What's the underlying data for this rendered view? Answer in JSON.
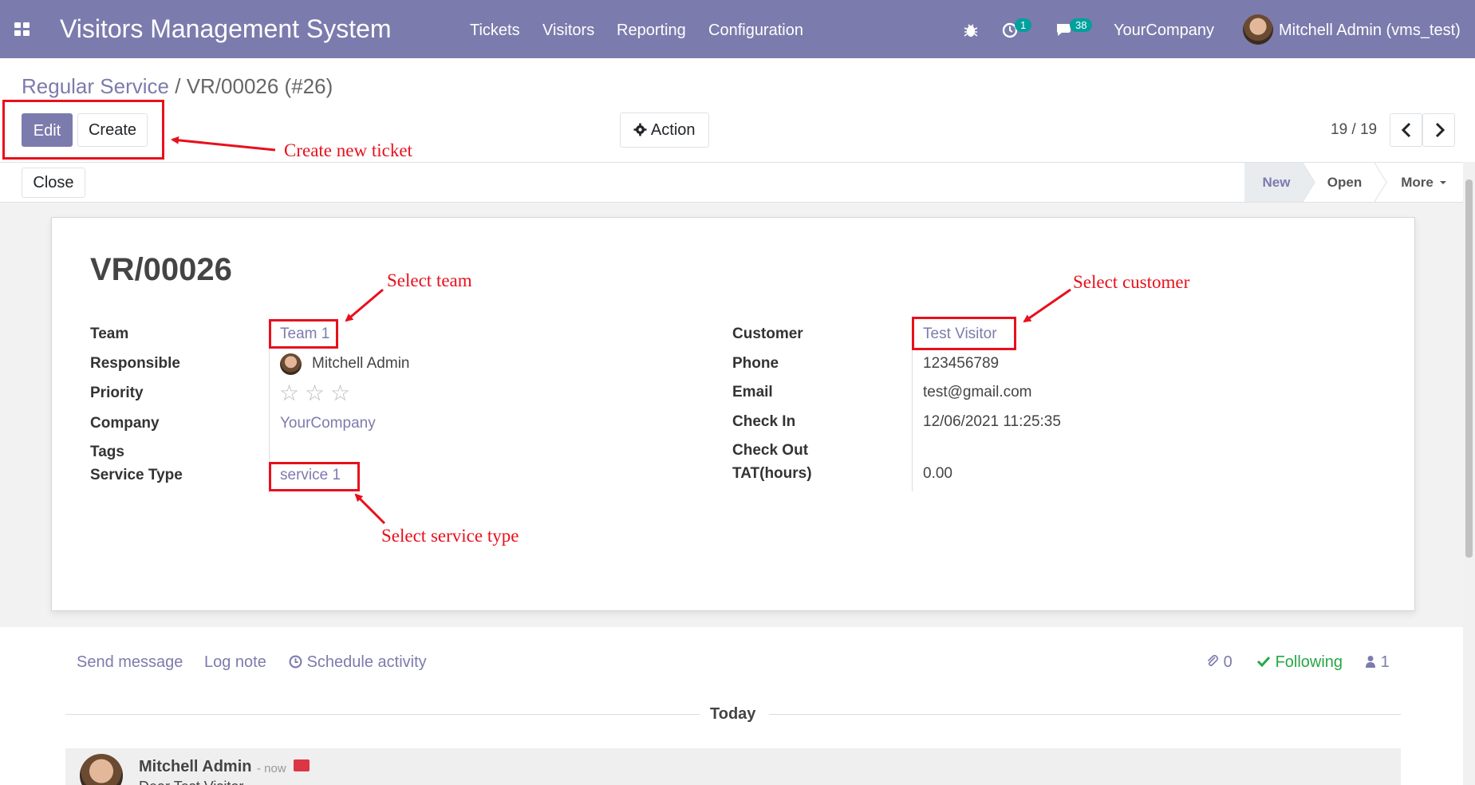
{
  "navbar": {
    "brand": "Visitors Management System",
    "menu": [
      "Tickets",
      "Visitors",
      "Reporting",
      "Configuration"
    ],
    "activity_count": "1",
    "message_count": "38",
    "company": "YourCompany",
    "user": "Mitchell Admin (vms_test)"
  },
  "breadcrumb": {
    "parent": "Regular Service",
    "separator": "/",
    "current": "VR/00026 (#26)"
  },
  "toolbar": {
    "edit": "Edit",
    "create": "Create",
    "action": "Action",
    "pager": "19 / 19"
  },
  "statusbar": {
    "close": "Close",
    "stages": [
      "New",
      "Open",
      "More"
    ],
    "active_stage": "New"
  },
  "record": {
    "title": "VR/00026",
    "left": {
      "team_label": "Team",
      "team": "Team 1",
      "responsible_label": "Responsible",
      "responsible": "Mitchell Admin",
      "priority_label": "Priority",
      "priority_stars": 0,
      "priority_max": 3,
      "company_label": "Company",
      "company": "YourCompany",
      "tags_label": "Tags",
      "service_type_label": "Service Type",
      "service_type": "service 1"
    },
    "right": {
      "customer_label": "Customer",
      "customer": "Test Visitor",
      "phone_label": "Phone",
      "phone": "123456789",
      "email_label": "Email",
      "email": "test@gmail.com",
      "checkin_label": "Check In",
      "checkin": "12/06/2021 11:25:35",
      "checkout_label": "Check Out",
      "tat_label": "TAT(hours)",
      "tat": "0.00"
    }
  },
  "chatter": {
    "send_message": "Send message",
    "log_note": "Log note",
    "schedule_activity": "Schedule activity",
    "attachments": "0",
    "following": "Following",
    "followers": "1",
    "today": "Today",
    "message": {
      "author": "Mitchell Admin",
      "time": "- now",
      "body": "Dear Test Visitor"
    }
  },
  "annotations": {
    "create_ticket": "Create new ticket",
    "select_team": "Select team",
    "select_customer": "Select customer",
    "select_service_type": "Select service type"
  },
  "colors": {
    "brand": "#7c7bad",
    "annotation": "#e8101c",
    "badge": "#00a09d",
    "following": "#28a745"
  }
}
